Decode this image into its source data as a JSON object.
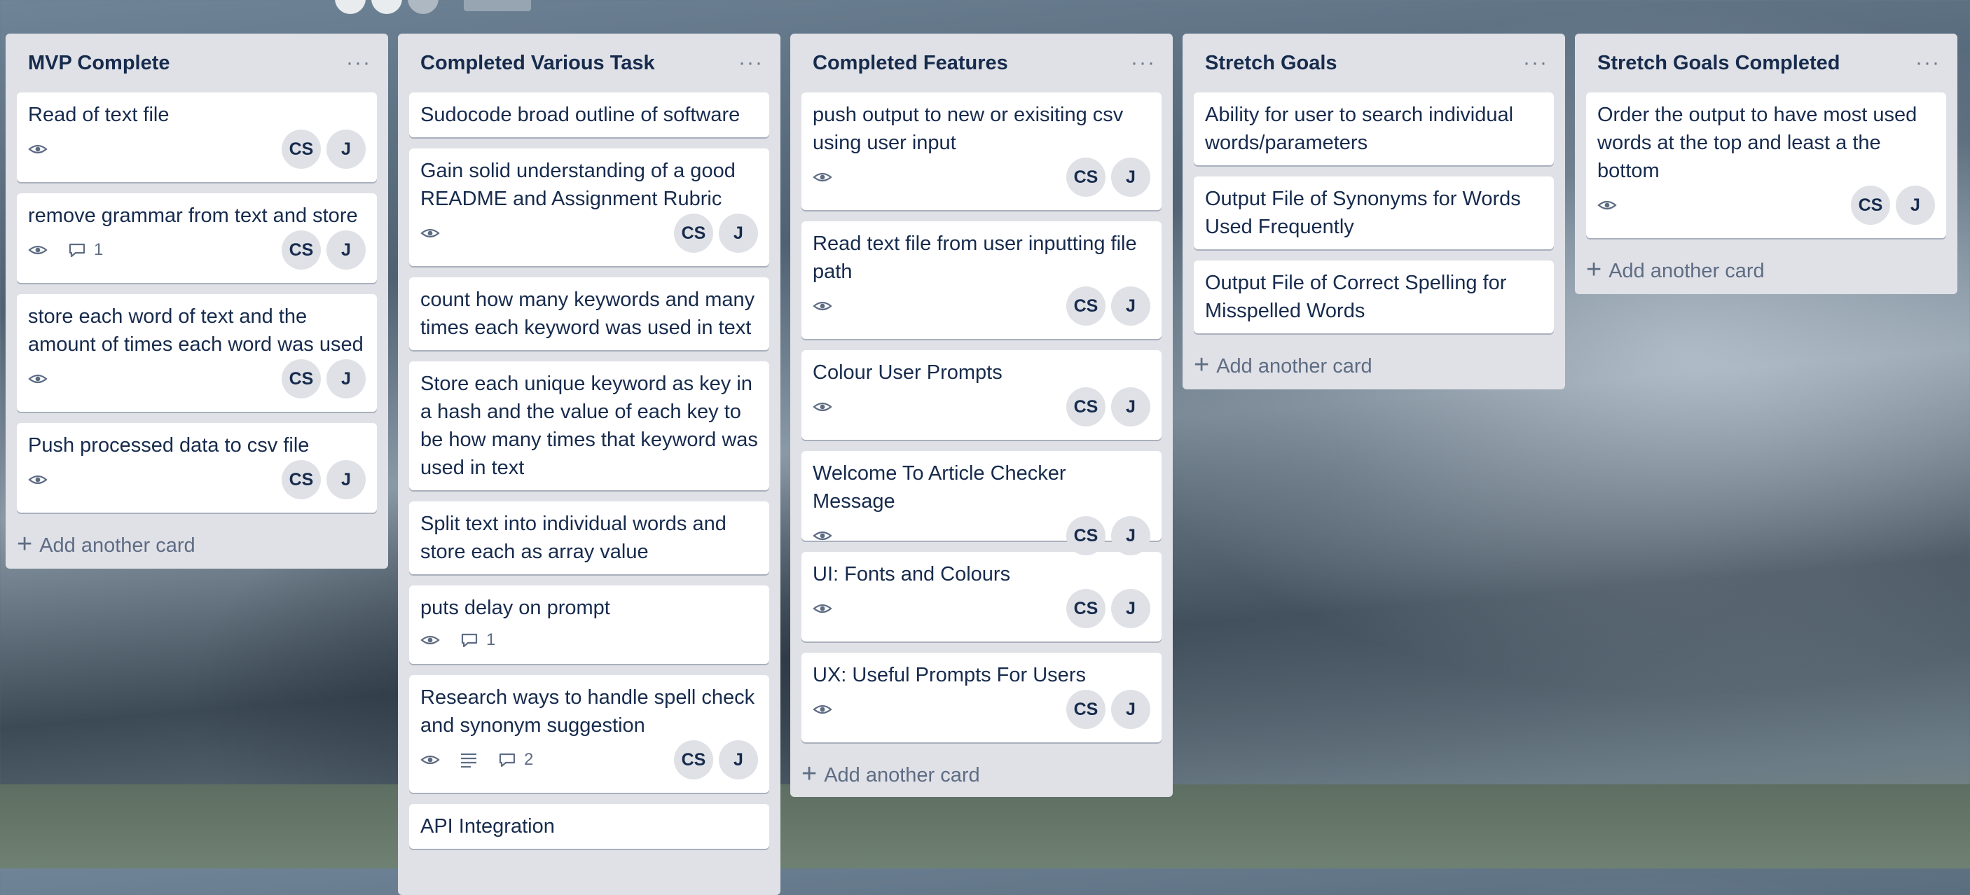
{
  "board": {
    "lists": [
      {
        "title": "MVP Complete",
        "add_label": "Add another card",
        "cards": [
          {
            "title": "Read of text file",
            "comments": "",
            "members": [
              "CS",
              "J"
            ]
          },
          {
            "title": "remove grammar from text and store",
            "comments": "1",
            "members": [
              "CS",
              "J"
            ]
          },
          {
            "title": "store each word of text and the amount of times each word was used",
            "comments": "",
            "members": [
              "CS",
              "J"
            ]
          },
          {
            "title": "Push processed data to csv file",
            "comments": "",
            "members": [
              "CS",
              "J"
            ]
          }
        ]
      },
      {
        "title": "Completed Various Task",
        "add_label": "",
        "cards": [
          {
            "title": "Sudocode broad outline of software"
          },
          {
            "title": "Gain solid understanding of a good README and Assignment Rubric",
            "members": [
              "CS",
              "J"
            ]
          },
          {
            "title": "count how many keywords and many times each keyword was used in text"
          },
          {
            "title": "Store each unique keyword as key in a hash and the value of each key to be how many times that keyword was used in text"
          },
          {
            "title": "Split text into individual words and store each as array value"
          },
          {
            "title": "puts delay on prompt",
            "comments": "1"
          },
          {
            "title": "Research ways to handle spell check and synonym suggestion",
            "comments": "2",
            "members": [
              "CS",
              "J"
            ]
          },
          {
            "title": "API Integration"
          }
        ]
      },
      {
        "title": "Completed Features",
        "add_label": "Add another card",
        "cards": [
          {
            "title": "push output to new or exisiting csv using user input",
            "members": [
              "CS",
              "J"
            ]
          },
          {
            "title": "Read text file from user inputting file path",
            "members": [
              "CS",
              "J"
            ]
          },
          {
            "title": "Colour User Prompts",
            "members": [
              "CS",
              "J"
            ]
          },
          {
            "title": "Welcome To Article Checker Message",
            "members": [
              "CS",
              "J"
            ]
          },
          {
            "title": "UI: Fonts and Colours",
            "members": [
              "CS",
              "J"
            ]
          },
          {
            "title": "UX: Useful Prompts For Users",
            "members": [
              "CS",
              "J"
            ]
          }
        ]
      },
      {
        "title": "Stretch Goals",
        "add_label": "Add another card",
        "cards": [
          {
            "title": "Ability for user to search individual words/parameters"
          },
          {
            "title": "Output File of Synonyms for Words Used Frequently"
          },
          {
            "title": "Output File of Correct Spelling for Misspelled Words"
          }
        ]
      },
      {
        "title": "Stretch Goals Completed",
        "add_label": "Add another card",
        "cards": [
          {
            "title": "Order the output to have most used words at the top and least a the bottom",
            "members": [
              "CS",
              "J"
            ]
          }
        ]
      }
    ]
  }
}
